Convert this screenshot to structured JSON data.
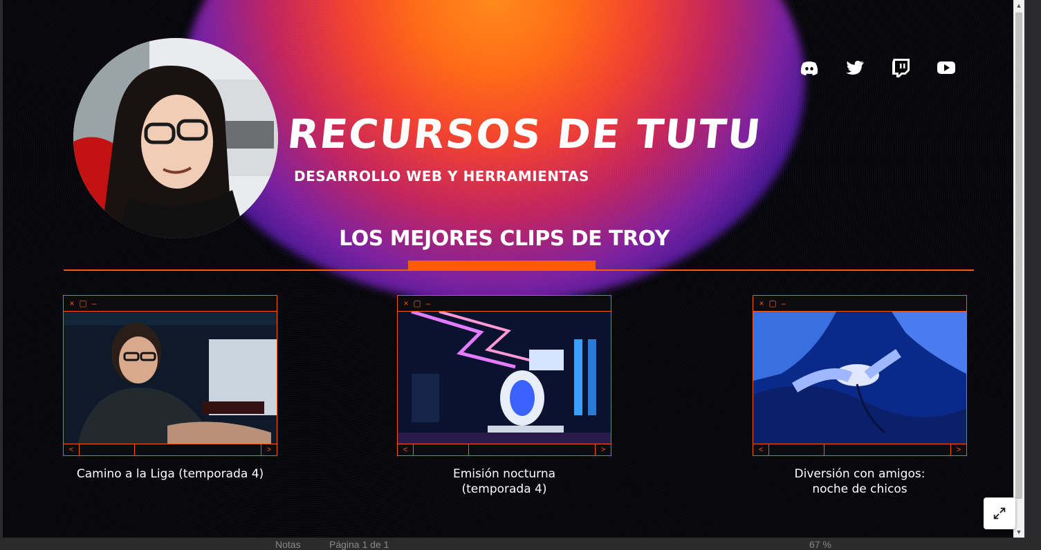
{
  "slide": {
    "title": "RECURSOS DE TUTU",
    "subtitle": "DESARROLLO WEB Y HERRAMIENTAS",
    "section_title": "LOS MEJORES CLIPS DE TROY"
  },
  "socials": [
    {
      "icon": "discord-icon"
    },
    {
      "icon": "twitter-icon"
    },
    {
      "icon": "twitch-icon"
    },
    {
      "icon": "youtube-icon"
    }
  ],
  "cards": [
    {
      "window_controls": [
        "×",
        "▢",
        "–"
      ],
      "prev": "<",
      "next": ">",
      "caption": "Camino a la Liga (temporada 4)"
    },
    {
      "window_controls": [
        "×",
        "▢",
        "–"
      ],
      "prev": "<",
      "next": ">",
      "caption_line1": "Emisión nocturna",
      "caption_line2": "(temporada 4)"
    },
    {
      "window_controls": [
        "×",
        "▢",
        "–"
      ],
      "prev": "<",
      "next": ">",
      "caption_line1": "Diversión con amigos:",
      "caption_line2": "noche de chicos"
    }
  ],
  "statusbar": {
    "notes": "Notas",
    "page": "Página 1 de 1",
    "zoom": "67 %"
  },
  "colors": {
    "accent": "#ff5a0a",
    "background": "#05050a"
  }
}
